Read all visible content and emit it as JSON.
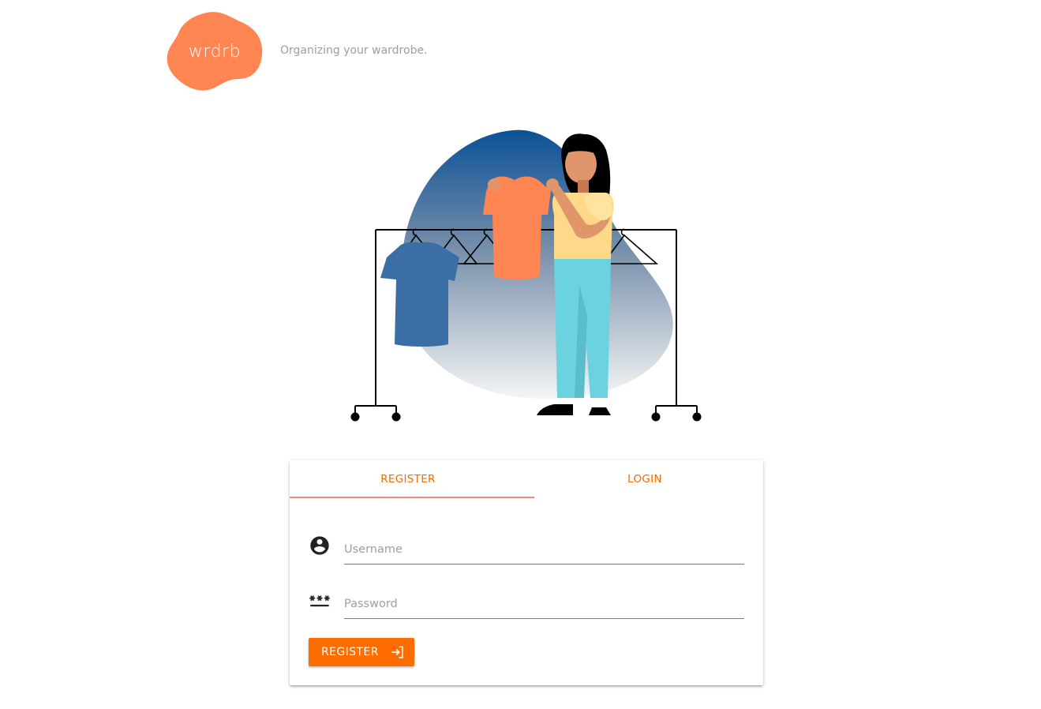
{
  "header": {
    "logo_text": "wrdrb",
    "tagline": "Organizing your wardrobe."
  },
  "illustration": {
    "description_icon": "woman-holding-shirt-illustration"
  },
  "auth_card": {
    "tabs": [
      {
        "label": "REGISTER",
        "active": true
      },
      {
        "label": "LOGIN",
        "active": false
      }
    ],
    "username": {
      "placeholder": "Username",
      "value": "",
      "icon": "account-circle-icon"
    },
    "password": {
      "placeholder": "Password",
      "value": "",
      "icon": "password-icon"
    },
    "submit": {
      "label": "REGISTER",
      "icon": "login-icon"
    }
  },
  "colors": {
    "brand": "#ff8552",
    "accent": "#ff6d00",
    "tab_text": "#ef6c00",
    "tab_indicator": "#f28a7f"
  }
}
